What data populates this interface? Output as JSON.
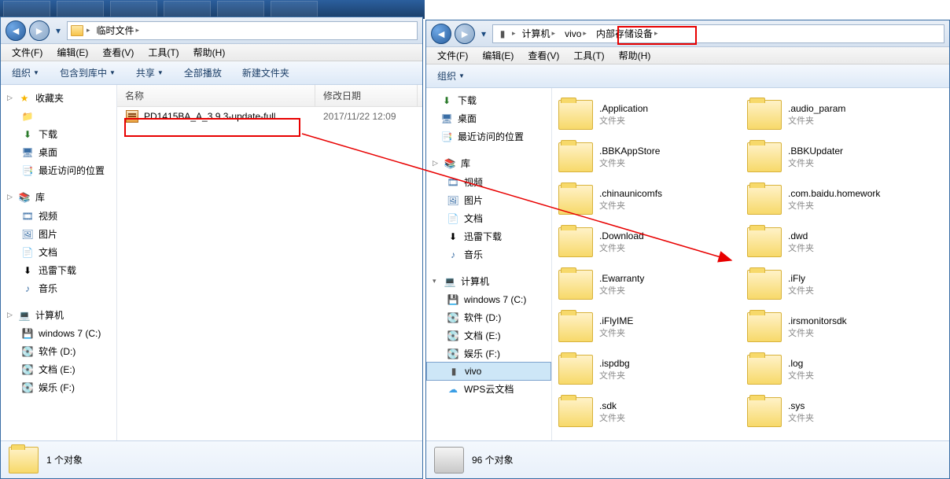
{
  "left": {
    "breadcrumb": [
      "临时文件"
    ],
    "menu": [
      "文件(F)",
      "编辑(E)",
      "查看(V)",
      "工具(T)",
      "帮助(H)"
    ],
    "toolbar": [
      "组织",
      "包含到库中",
      "共享",
      "全部播放",
      "新建文件夹"
    ],
    "columns": {
      "name": "名称",
      "modified": "修改日期"
    },
    "file": {
      "name": "PD1415BA_A_3.9.3-update-full",
      "modified": "2017/11/22 12:09"
    },
    "sidebar": {
      "favorites": "收藏夹",
      "fav_items": [
        "",
        "下载",
        "桌面",
        "最近访问的位置"
      ],
      "libraries": "库",
      "lib_items": [
        "视频",
        "图片",
        "文档",
        "迅雷下载",
        "音乐"
      ],
      "computer": "计算机",
      "comp_items": [
        "windows 7 (C:)",
        "软件 (D:)",
        "文档 (E:)",
        "娱乐 (F:)"
      ]
    },
    "status": "1 个对象"
  },
  "right": {
    "breadcrumb": [
      "计算机",
      "vivo",
      "内部存储设备"
    ],
    "menu": [
      "文件(F)",
      "编辑(E)",
      "查看(V)",
      "工具(T)",
      "帮助(H)"
    ],
    "toolbar": [
      "组织"
    ],
    "sidebar": {
      "fav_items": [
        "下载",
        "桌面",
        "最近访问的位置"
      ],
      "libraries": "库",
      "lib_items": [
        "视频",
        "图片",
        "文档",
        "迅雷下载",
        "音乐"
      ],
      "computer": "计算机",
      "comp_items": [
        "windows 7 (C:)",
        "软件 (D:)",
        "文档 (E:)",
        "娱乐 (F:)",
        "vivo",
        "WPS云文档"
      ]
    },
    "folders": [
      ".Application",
      ".audio_param",
      ".BBKAppStore",
      ".BBKUpdater",
      ".chinaunicomfs",
      ".com.baidu.homework",
      ".Download",
      ".dwd",
      ".Ewarranty",
      ".iFly",
      ".iFlyIME",
      ".irsmonitorsdk",
      ".ispdbg",
      ".log",
      ".sdk",
      ".sys"
    ],
    "folder_type": "文件夹",
    "status": "96 个对象"
  }
}
